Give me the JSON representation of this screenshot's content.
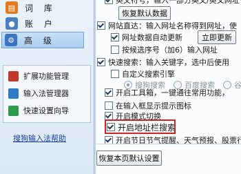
{
  "sidebar": {
    "categories": [
      {
        "label": "词 库",
        "icon": "book-icon",
        "color": "#e07b22"
      },
      {
        "label": "账 户",
        "icon": "user-icon",
        "color": "#4a7fc1"
      },
      {
        "label": "高 级",
        "icon": "gear-icon",
        "color": "#3b74c2"
      }
    ],
    "tools": [
      {
        "label": "扩展功能管理",
        "icon": "puzzle-icon",
        "color": "#c0392b"
      },
      {
        "label": "输入法管理器",
        "icon": "manager-icon",
        "color": "#2e7bc4"
      },
      {
        "label": "快速设置向导",
        "icon": "wizard-icon",
        "color": "#2f9a48"
      }
    ],
    "help_link": "搜狗输入法帮助"
  },
  "panel": {
    "top_cut_text": "英文符号，输入一部分英文/英文网址",
    "restore_default_data_button": "恢复默认数据",
    "website_direct": {
      "label": "网站直达：输入网址名称得到网址，使",
      "checked": true
    },
    "url_data_auto_update": {
      "label": "网址数据自动更新",
      "checked": true
    },
    "update_now_button": "立即更新",
    "candidate_url": {
      "label": "按候选序号（加6）输入网址",
      "checked": false
    },
    "quick_search": {
      "label": "快速搜索：输入关键字，选中后使用",
      "checked": true
    },
    "custom_search_engine": {
      "label": "自定义搜索引擎",
      "checked": false
    },
    "engines": [
      {
        "label": "搜狗搜索",
        "selected": true
      },
      {
        "label": "百度搜索",
        "selected": false
      },
      {
        "label": "谷",
        "selected": false
      }
    ],
    "toolbar": {
      "label": "开启工具箱，一键通往常用功能，",
      "checked": true
    },
    "input_box_icon": {
      "label": "在输入框显示提示图标",
      "checked": false
    },
    "mode_switch": {
      "label": "开启模式切换",
      "checked": true
    },
    "address_bar_search": {
      "label": "开启地址栏搜索",
      "checked": true
    },
    "festival_reminder": {
      "label": "开启节日节气提醒、天气预报、股票行",
      "checked": true
    },
    "restore_page_default_button": "恢复本页默认设置"
  },
  "colors": {
    "highlight": "#d21f1f",
    "link": "#1a3fa5"
  }
}
